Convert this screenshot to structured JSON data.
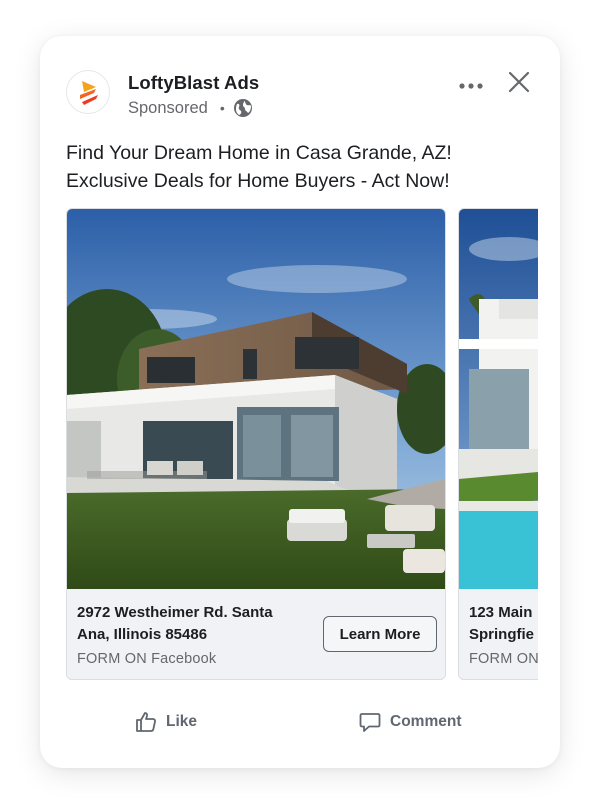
{
  "ad": {
    "advertiser": "LoftyBlast Ads",
    "sponsored_label": "Sponsored",
    "separator": "•",
    "audience_icon": "globe-icon",
    "body_line1": "Find Your Dream Home in Casa Grande, AZ!",
    "body_line2": "Exclusive Deals for Home Buyers - Act Now!"
  },
  "carousel": {
    "cards": [
      {
        "address_line1": "2972 Westheimer Rd. Santa",
        "address_line2": "Ana, Illinois 85486",
        "source": "FORM ON Facebook",
        "cta": "Learn More"
      },
      {
        "address_line1": "123 Main",
        "address_line2": "Springfie",
        "source": "FORM ON"
      }
    ]
  },
  "actions": {
    "like": "Like",
    "comment": "Comment"
  },
  "colors": {
    "brand_orange": "#f26522",
    "text_primary": "#1c1e21",
    "text_secondary": "#65676b",
    "caption_bg": "#f0f2f5"
  }
}
